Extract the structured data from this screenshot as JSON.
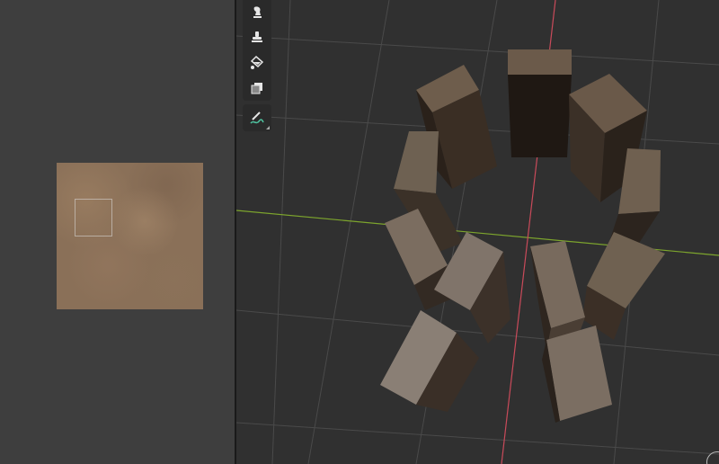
{
  "app": {
    "left_panel": {
      "type": "texture-paint-preview",
      "texture": "stone-brown"
    },
    "viewport": {
      "object": "ring-of-stone-blocks",
      "block_count": 12,
      "axis_x_color": "#7da52d",
      "axis_y_color": "#c94a5a",
      "grid_color": "#4a4a4a",
      "background_color": "#303030"
    },
    "toolbar": {
      "tools": [
        {
          "name": "smear-tool",
          "icon": "smear-icon"
        },
        {
          "name": "clone-tool",
          "icon": "stamp-icon"
        },
        {
          "name": "fill-tool",
          "icon": "paint-bucket-icon"
        },
        {
          "name": "mask-tool",
          "icon": "mask-icon"
        },
        {
          "name": "annotate-tool",
          "icon": "annotate-pen-icon"
        }
      ]
    }
  }
}
